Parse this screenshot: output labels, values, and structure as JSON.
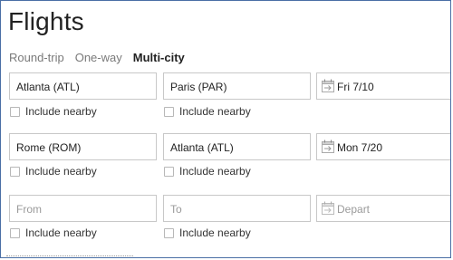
{
  "header": {
    "title": "Flights"
  },
  "tabs": [
    {
      "label": "Round-trip"
    },
    {
      "label": "One-way"
    },
    {
      "label": "Multi-city"
    }
  ],
  "active_tab": "Multi-city",
  "legs": [
    {
      "from": "Atlanta (ATL)",
      "to": "Paris (PAR)",
      "date": "Fri 7/10",
      "from_nearby": "Include nearby",
      "to_nearby": "Include nearby"
    },
    {
      "from": "Rome (ROM)",
      "to": "Atlanta (ATL)",
      "date": "Mon 7/20",
      "from_nearby": "Include nearby",
      "to_nearby": "Include nearby"
    },
    {
      "from_placeholder": "From",
      "to_placeholder": "To",
      "date_placeholder": "Depart",
      "from_nearby": "Include nearby",
      "to_nearby": "Include nearby"
    }
  ],
  "icons": {
    "calendar": "calendar-icon",
    "checkbox": "checkbox"
  }
}
